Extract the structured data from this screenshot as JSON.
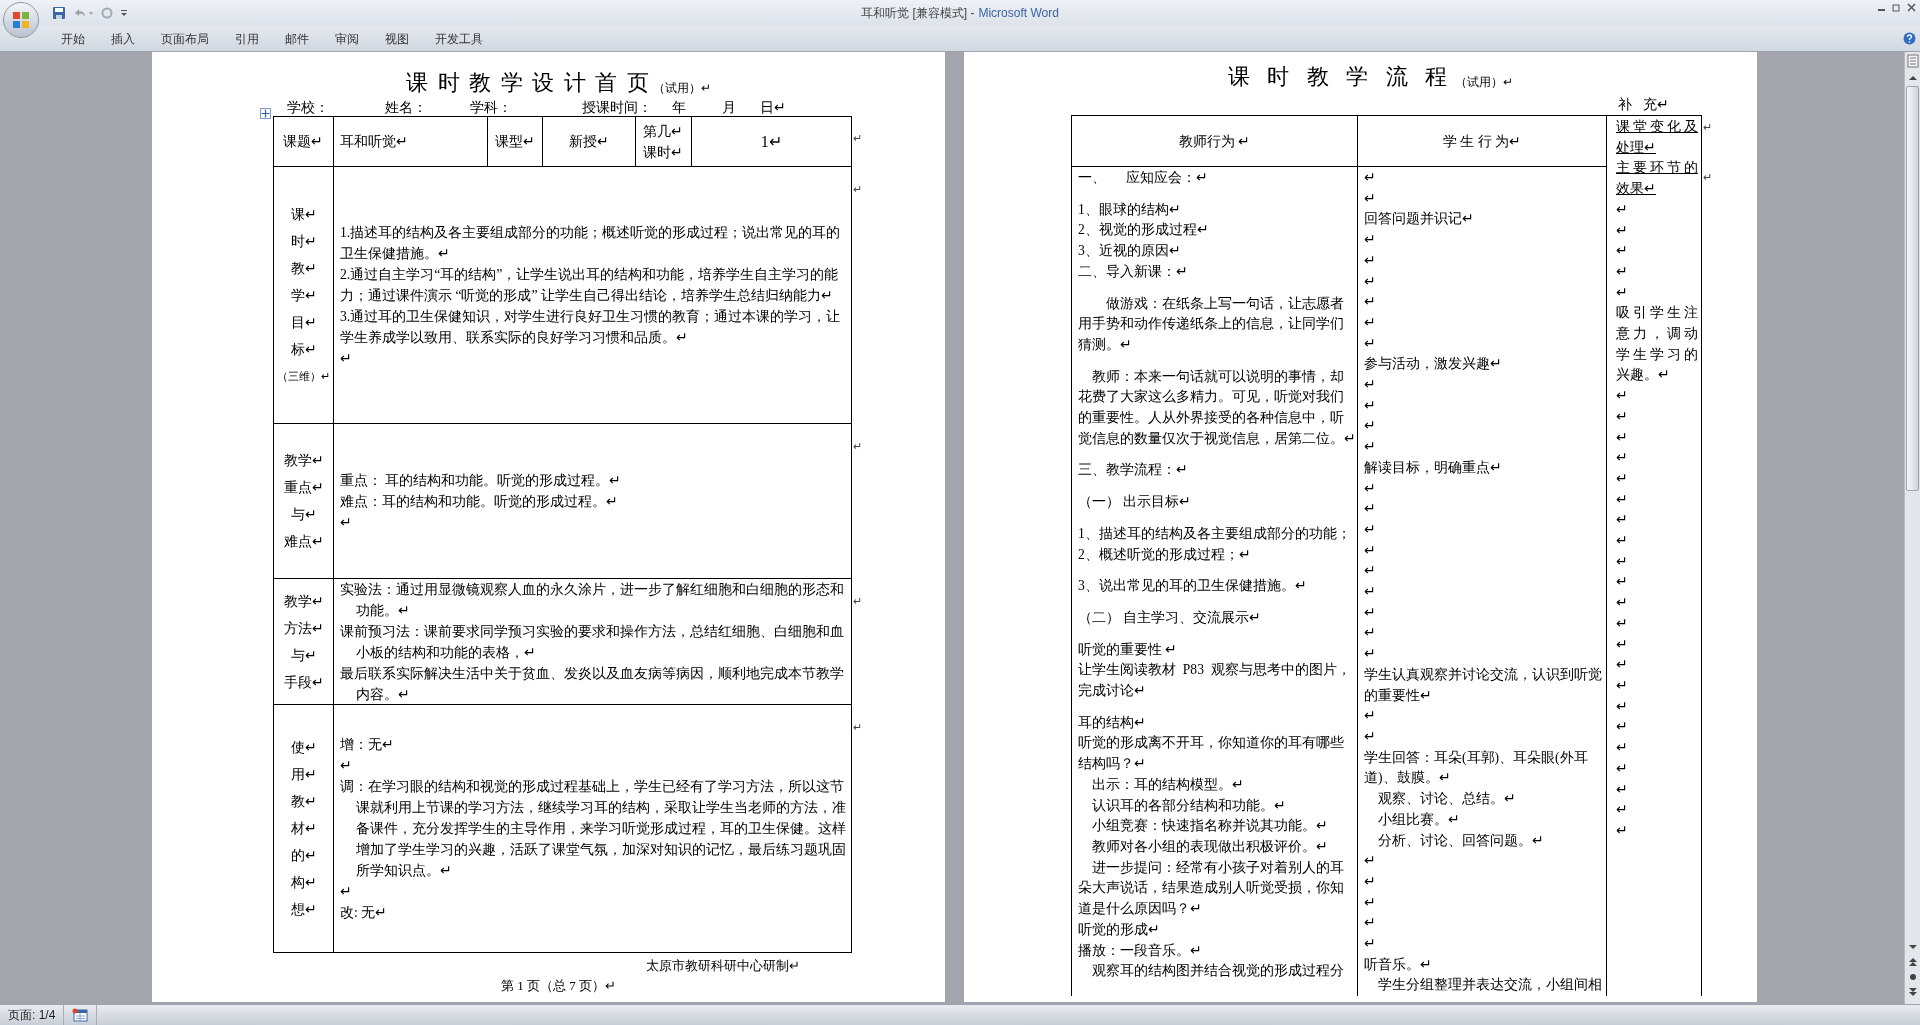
{
  "window": {
    "document_title": "耳和听觉 [兼容模式] -",
    "app_name": "Microsoft Word"
  },
  "ribbon_tabs": [
    "开始",
    "插入",
    "页面布局",
    "引用",
    "邮件",
    "审阅",
    "视图",
    "开发工具"
  ],
  "left_page": {
    "title": "课 时 教 学 设 计 首 页",
    "title_note": "（试用）↵",
    "header_fields": [
      "学校：",
      "姓名：",
      "学科：",
      "授课时间：",
      "年",
      "月",
      "日↵"
    ],
    "header_row": [
      [
        "课题↵"
      ],
      [
        "耳和听觉↵"
      ],
      [
        "课型↵"
      ],
      [
        "新授↵"
      ],
      [
        "第几↵",
        "课时↵"
      ],
      [
        "1↵"
      ]
    ],
    "header_end_mark": "↵",
    "rows": [
      {
        "label": [
          "课↵",
          "时↵",
          "教↵",
          "学↵",
          "目↵",
          "标↵",
          "（三维）↵"
        ],
        "paragraphs": [
          "1.描述耳的结构及各主要组成部分的功能；概述听觉的形成过程；说出常见的耳的卫生保健措施。↵",
          "2.通过自主学习“耳的结构”，让学生说出耳的结构和功能，培养学生自主学习的能力；通过课件演示 “听觉的形成” 让学生自己得出结论，培养学生总结归纳能力↵",
          "3.通过耳的卫生保健知识，对学生进行良好卫生习惯的教育；通过本课的学习，让学生养成学以致用、联系实际的良好学习习惯和品质。↵",
          "↵"
        ],
        "end_mark": "↵"
      },
      {
        "label": [
          "教学↵",
          "重点↵",
          "与↵",
          "难点↵"
        ],
        "paragraphs": [
          "重点：      耳的结构和功能。听觉的形成过程。↵",
          "难点：耳的结构和功能。听觉的形成过程。↵",
          "↵"
        ],
        "end_mark": "↵"
      },
      {
        "label": [
          "教学↵",
          "方法↵",
          "与↵",
          "手段↵"
        ],
        "paragraphs": [
          "实验法：通过用显微镜观察人血的永久涂片，进一步了解红细胞和白细胞的形态和功能。↵",
          "课前预习法：课前要求同学预习实验的要求和操作方法，总结红细胞、白细胞和血小板的结构和功能的表格，↵",
          "最后联系实际解决生活中关于贫血、发炎以及血友病等病因，顺利地完成本节教学内容。↵"
        ],
        "end_mark": "↵"
      },
      {
        "label": [
          "使↵",
          "用↵",
          "教↵",
          "材↵",
          "的↵",
          "构↵",
          "想↵"
        ],
        "paragraphs": [
          "增：无↵",
          "↵",
          "调：在学习眼的结构和视觉的形成过程基础上，学生已经有了学习方法，所以这节课就利用上节课的学习方法，继续学习耳的结构，采取让学生当老师的方法，准备课件，充分发挥学生的主导作用，来学习听觉形成过程，耳的卫生保健。这样增加了学生学习的兴趣，活跃了课堂气氛，加深对知识的记忆，最后练习题巩固所学知识点。↵",
          "↵",
          "改: 无↵"
        ],
        "end_mark": "↵"
      }
    ],
    "footer_org": "太原市教研科研中心研制↵",
    "page_number": "第 1 页（总 7 页）↵"
  },
  "right_page": {
    "title": "课 时 教 学 流 程",
    "title_note": "（试用）↵",
    "supplement_label": "补   充↵",
    "columns": [
      "教师行为 ↵",
      "学 生 行 为↵"
    ],
    "end_marks": [
      "↵",
      "↵"
    ],
    "teacher_groups": [
      [
        "一、      应知应会：↵"
      ],
      [
        "1、眼球的结构↵",
        "2、视觉的形成过程↵",
        "3、近视的原因↵",
        "二、导入新课：↵"
      ],
      [
        "　　做游戏：在纸条上写一句话，让志愿者用手势和动作传递纸条上的信息，让同学们猜测。↵"
      ],
      [
        "　教师：本来一句话就可以说明的事情，却花费了大家这么多精力。可见，听觉对我们的重要性。人从外界接受的各种信息中，听觉信息的数量仅次于视觉信息，居第二位。↵"
      ],
      [
        "三、教学流程：↵"
      ],
      [
        "（一） 出示目标↵"
      ],
      [
        "1、描述耳的结构及各主要组成部分的功能；",
        "2、概述听觉的形成过程；↵"
      ],
      [
        "3、说出常见的耳的卫生保健措施。↵"
      ],
      [
        "（二） 自主学习、交流展示↵"
      ],
      [
        "听觉的重要性 ↵",
        "让学生阅读教材  P83  观察与思考中的图片，完成讨论↵"
      ],
      [
        "耳的结构↵",
        "听觉的形成离不开耳，你知道你的耳有哪些结构吗？↵",
        "　出示：耳的结构模型。↵",
        "　认识耳的各部分结构和功能。↵",
        "　小组竞赛：快速指名称并说其功能。↵",
        "　教师对各小组的表现做出积极评价。↵",
        "　进一步提问：经常有小孩子对着别人的耳朵大声说话，结果造成别人听觉受损，你知道是什么原因吗？↵",
        "听觉的形成↵",
        "播放：一段音乐。↵",
        "　观察耳的结构图并结合视觉的形成过程分"
      ]
    ],
    "student_paragraphs": [
      "↵",
      "↵",
      "回答问题并识记↵",
      "↵",
      "↵",
      "↵",
      "↵",
      "↵",
      "↵",
      "参与活动，激发兴趣↵",
      "↵",
      "↵",
      "↵",
      "↵",
      "解读目标，明确重点↵",
      "↵",
      "↵",
      "↵",
      "↵",
      "↵",
      "↵",
      "↵",
      "↵",
      "↵",
      "学生认真观察并讨论交流，认识到听觉的重要性↵",
      "↵",
      "↵",
      "学生回答：耳朵(耳郭)、耳朵眼(外耳道)、鼓膜。↵",
      "　观察、讨论、总结。↵",
      "　小组比赛。↵",
      "　分析、讨论、回答问题。↵",
      "↵",
      "↵",
      "↵",
      "↵",
      "↵",
      "听音乐。↵",
      "　学生分组整理并表达交流，小组间相"
    ],
    "note_headings": [
      "课堂变化及处理↵",
      "主要环节的效果↵"
    ],
    "note_paragraphs": [
      "↵",
      "↵",
      "↵",
      "↵",
      "↵",
      "吸引学生注意力，调动学生学习的兴趣。↵",
      "↵",
      "↵",
      "↵",
      "↵",
      "↵",
      "↵",
      "↵",
      "↵",
      "↵",
      "↵",
      "↵",
      "↵",
      "↵",
      "↵",
      "↵",
      "↵",
      "↵",
      "↵",
      "↵",
      "↵",
      "↵",
      "↵"
    ]
  },
  "status_bar": {
    "page": "页面: 1/4"
  }
}
